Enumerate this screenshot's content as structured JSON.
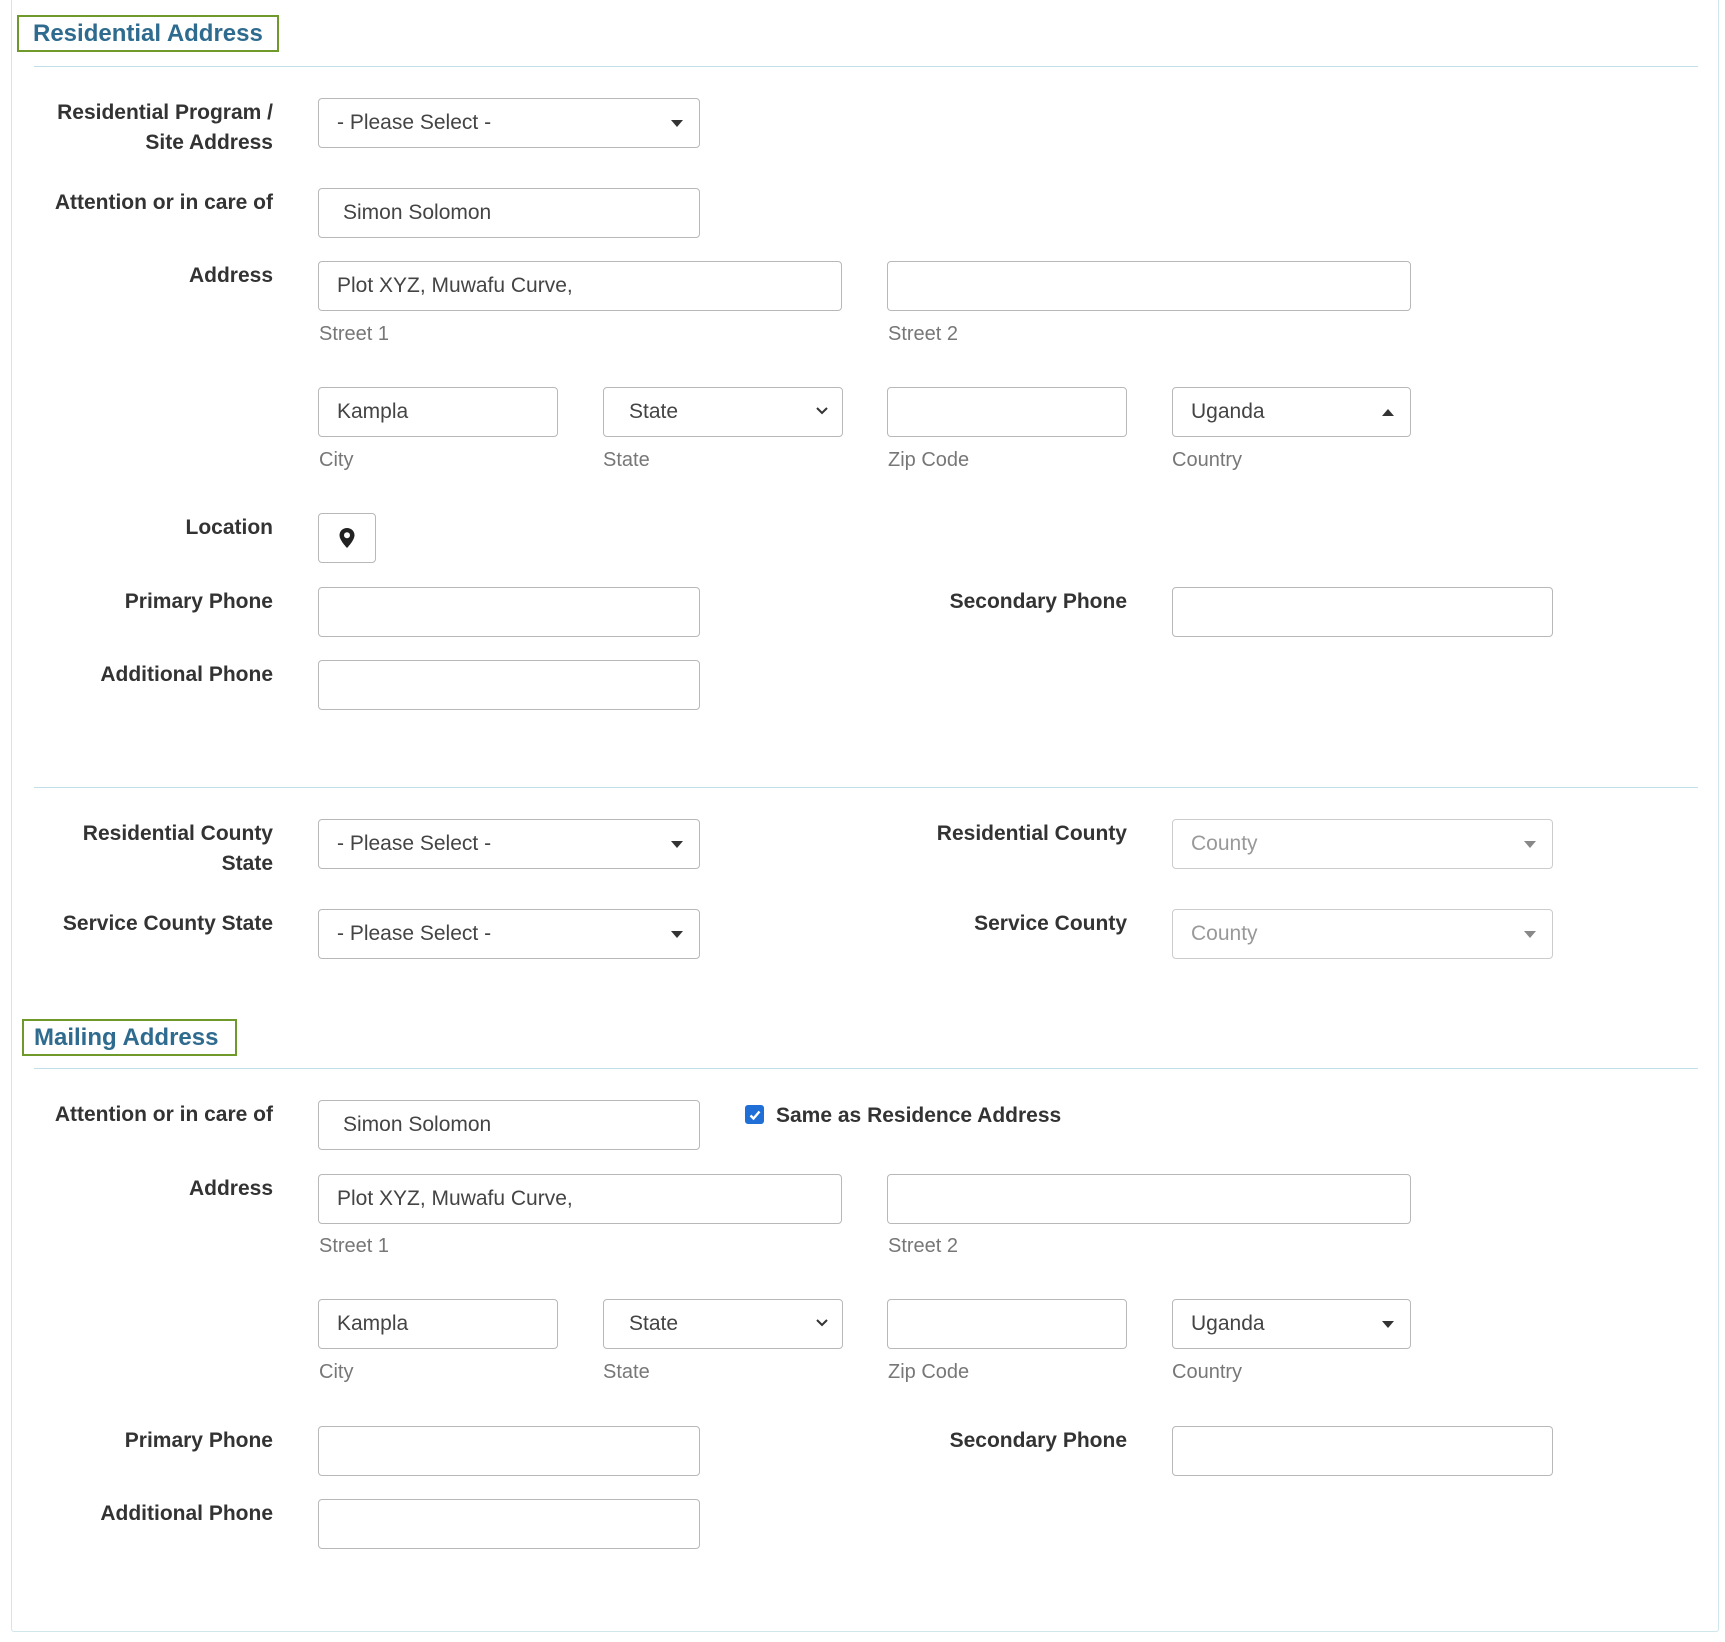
{
  "residential": {
    "title": "Residential Address",
    "program_label_1": "Residential Program /",
    "program_label_2": "Site Address",
    "program_value": "- Please Select -",
    "attention_label": "Attention or in care of",
    "attention_value": "Simon Solomon",
    "address_label": "Address",
    "street1_value": "Plot XYZ, Muwafu Curve,",
    "street2_value": "",
    "street1_caption": "Street 1",
    "street2_caption": "Street 2",
    "city_value": "Kampla",
    "state_value": "State",
    "zip_value": "",
    "country_value": "Uganda",
    "city_caption": "City",
    "state_caption": "State",
    "zip_caption": "Zip Code",
    "country_caption": "Country",
    "location_label": "Location",
    "primary_phone_label": "Primary Phone",
    "secondary_phone_label": "Secondary Phone",
    "additional_phone_label": "Additional Phone"
  },
  "county": {
    "res_county_state_label_1": "Residential County",
    "res_county_state_label_2": "State",
    "res_county_state_value": "- Please Select -",
    "res_county_label": "Residential County",
    "res_county_value": "County",
    "service_county_state_label": "Service County State",
    "service_county_state_value": "- Please Select -",
    "service_county_label": "Service County",
    "service_county_value": "County"
  },
  "mailing": {
    "title": "Mailing Address",
    "attention_label": "Attention or in care of",
    "attention_value": "Simon Solomon",
    "same_as_label": "Same as Residence Address",
    "same_as_checked": true,
    "address_label": "Address",
    "street1_value": "Plot XYZ, Muwafu Curve,",
    "street2_value": "",
    "street1_caption": "Street 1",
    "street2_caption": "Street 2",
    "city_value": "Kampla",
    "state_value": "State",
    "zip_value": "",
    "country_value": "Uganda",
    "city_caption": "City",
    "state_caption": "State",
    "zip_caption": "Zip Code",
    "country_caption": "Country",
    "primary_phone_label": "Primary Phone",
    "secondary_phone_label": "Secondary Phone",
    "additional_phone_label": "Additional Phone"
  },
  "icons": {
    "location": "map-marker-icon",
    "dropdown": "caret-down-icon",
    "select_chevron": "chevron-down-icon",
    "checkbox": "checkmark-icon"
  },
  "colors": {
    "section_border": "#6f9a2b",
    "section_title": "#2e6b8f",
    "divider": "#bfe0e6",
    "checkbox": "#1f6fd6"
  }
}
